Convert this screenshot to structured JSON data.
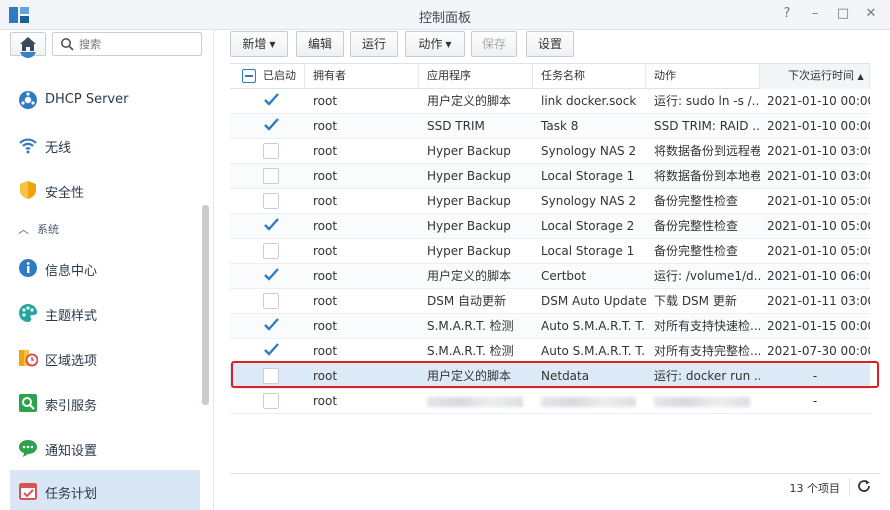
{
  "window": {
    "title": "控制面板"
  },
  "sidebar": {
    "search_placeholder": "搜索",
    "items": [
      {
        "label": "DHCP Server",
        "icon": "dhcp-icon"
      },
      {
        "label": "无线",
        "icon": "wifi-icon"
      },
      {
        "label": "安全性",
        "icon": "shield-icon"
      },
      {
        "label": "系统",
        "icon": "chevron-up-icon",
        "section": true
      },
      {
        "label": "信息中心",
        "icon": "info-icon"
      },
      {
        "label": "主题样式",
        "icon": "palette-icon"
      },
      {
        "label": "区域选项",
        "icon": "clock-icon"
      },
      {
        "label": "索引服务",
        "icon": "search-index-icon"
      },
      {
        "label": "通知设置",
        "icon": "chat-icon"
      },
      {
        "label": "任务计划",
        "icon": "calendar-check-icon",
        "active": true
      }
    ]
  },
  "toolbar": {
    "create": "新增",
    "edit": "编辑",
    "run": "运行",
    "action": "动作",
    "save": "保存",
    "settings": "设置"
  },
  "grid": {
    "columns": [
      "已启动",
      "拥有者",
      "应用程序",
      "任务名称",
      "动作",
      "下次运行时间"
    ],
    "sort_indicator": "▲",
    "rows": [
      {
        "enabled": true,
        "owner": "root",
        "app": "用户定义的脚本",
        "task": "link docker.sock",
        "action": "运行: sudo ln -s /...",
        "next": "2021-01-10 00:00"
      },
      {
        "enabled": true,
        "owner": "root",
        "app": "SSD TRIM",
        "task": "Task 8",
        "action": "SSD TRIM: RAID ...",
        "next": "2021-01-10 00:00"
      },
      {
        "enabled": false,
        "owner": "root",
        "app": "Hyper Backup",
        "task": "Synology NAS 2",
        "action": "将数据备份到远程卷",
        "next": "2021-01-10 03:00"
      },
      {
        "enabled": false,
        "owner": "root",
        "app": "Hyper Backup",
        "task": "Local Storage 1",
        "action": "将数据备份到本地卷",
        "next": "2021-01-10 03:00"
      },
      {
        "enabled": false,
        "owner": "root",
        "app": "Hyper Backup",
        "task": "Synology NAS 2",
        "action": "备份完整性检查",
        "next": "2021-01-10 05:00"
      },
      {
        "enabled": true,
        "owner": "root",
        "app": "Hyper Backup",
        "task": "Local Storage 2",
        "action": "备份完整性检查",
        "next": "2021-01-10 05:00"
      },
      {
        "enabled": false,
        "owner": "root",
        "app": "Hyper Backup",
        "task": "Local Storage 1",
        "action": "备份完整性检查",
        "next": "2021-01-10 05:00"
      },
      {
        "enabled": true,
        "owner": "root",
        "app": "用户定义的脚本",
        "task": "Certbot",
        "action": "运行: /volume1/d...",
        "next": "2021-01-10 06:00"
      },
      {
        "enabled": false,
        "owner": "root",
        "app": "DSM 自动更新",
        "task": "DSM Auto Update",
        "action": "下载 DSM 更新",
        "next": "2021-01-11 03:00"
      },
      {
        "enabled": true,
        "owner": "root",
        "app": "S.M.A.R.T. 检测",
        "task": "Auto S.M.A.R.T. T...",
        "action": "对所有支持快速检...",
        "next": "2021-01-15 00:00"
      },
      {
        "enabled": true,
        "owner": "root",
        "app": "S.M.A.R.T. 检测",
        "task": "Auto S.M.A.R.T. T...",
        "action": "对所有支持完整检...",
        "next": "2021-07-30 00:00"
      },
      {
        "enabled": false,
        "owner": "root",
        "app": "用户定义的脚本",
        "task": "Netdata",
        "action": "运行: docker run ...",
        "next": "-",
        "selected": true
      },
      {
        "enabled": false,
        "owner": "root",
        "app": "",
        "task": "",
        "action": "",
        "next": "-",
        "redacted": true
      }
    ]
  },
  "footer": {
    "count": "13 个项目"
  },
  "colors": {
    "accent": "#2f7bc1",
    "highlight": "#e02020",
    "selected_row": "#dce9f6"
  }
}
